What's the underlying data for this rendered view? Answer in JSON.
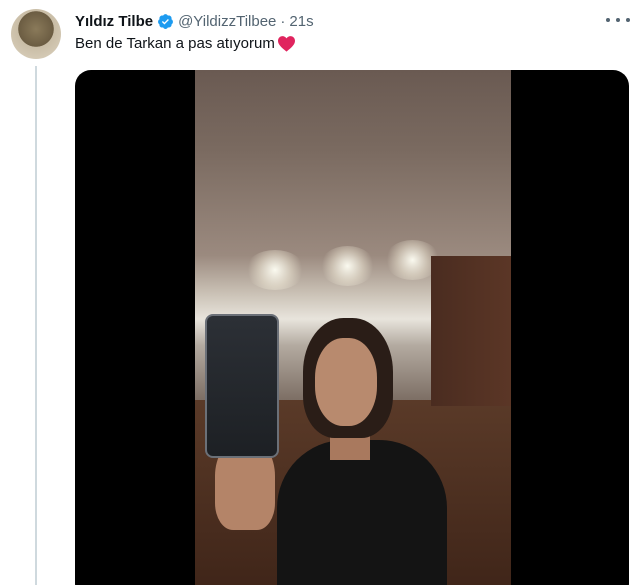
{
  "tweet": {
    "display_name": "Yıldız Tilbe",
    "handle": "@YildizzTilbee",
    "separator": "·",
    "time": "21s",
    "text": "Ben de Tarkan a pas atıyorum",
    "verified": true
  },
  "icons": {
    "verified": "verified-badge-icon",
    "more": "more-options-icon",
    "heart": "red-heart-emoji"
  },
  "colors": {
    "verified_blue": "#1d9bf0",
    "heart_red": "#e0245e",
    "name_text": "#0f1419",
    "secondary_text": "#536471",
    "thread_line": "#cfd9de"
  }
}
